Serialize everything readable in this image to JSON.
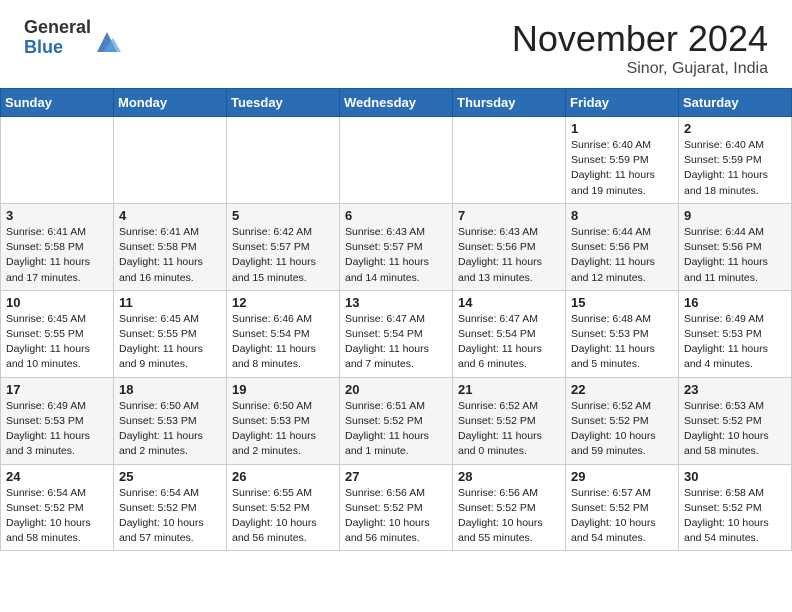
{
  "header": {
    "logo_general": "General",
    "logo_blue": "Blue",
    "month_title": "November 2024",
    "location": "Sinor, Gujarat, India"
  },
  "calendar": {
    "days_of_week": [
      "Sunday",
      "Monday",
      "Tuesday",
      "Wednesday",
      "Thursday",
      "Friday",
      "Saturday"
    ],
    "weeks": [
      [
        {
          "day": "",
          "info": ""
        },
        {
          "day": "",
          "info": ""
        },
        {
          "day": "",
          "info": ""
        },
        {
          "day": "",
          "info": ""
        },
        {
          "day": "",
          "info": ""
        },
        {
          "day": "1",
          "info": "Sunrise: 6:40 AM\nSunset: 5:59 PM\nDaylight: 11 hours and 19 minutes."
        },
        {
          "day": "2",
          "info": "Sunrise: 6:40 AM\nSunset: 5:59 PM\nDaylight: 11 hours and 18 minutes."
        }
      ],
      [
        {
          "day": "3",
          "info": "Sunrise: 6:41 AM\nSunset: 5:58 PM\nDaylight: 11 hours and 17 minutes."
        },
        {
          "day": "4",
          "info": "Sunrise: 6:41 AM\nSunset: 5:58 PM\nDaylight: 11 hours and 16 minutes."
        },
        {
          "day": "5",
          "info": "Sunrise: 6:42 AM\nSunset: 5:57 PM\nDaylight: 11 hours and 15 minutes."
        },
        {
          "day": "6",
          "info": "Sunrise: 6:43 AM\nSunset: 5:57 PM\nDaylight: 11 hours and 14 minutes."
        },
        {
          "day": "7",
          "info": "Sunrise: 6:43 AM\nSunset: 5:56 PM\nDaylight: 11 hours and 13 minutes."
        },
        {
          "day": "8",
          "info": "Sunrise: 6:44 AM\nSunset: 5:56 PM\nDaylight: 11 hours and 12 minutes."
        },
        {
          "day": "9",
          "info": "Sunrise: 6:44 AM\nSunset: 5:56 PM\nDaylight: 11 hours and 11 minutes."
        }
      ],
      [
        {
          "day": "10",
          "info": "Sunrise: 6:45 AM\nSunset: 5:55 PM\nDaylight: 11 hours and 10 minutes."
        },
        {
          "day": "11",
          "info": "Sunrise: 6:45 AM\nSunset: 5:55 PM\nDaylight: 11 hours and 9 minutes."
        },
        {
          "day": "12",
          "info": "Sunrise: 6:46 AM\nSunset: 5:54 PM\nDaylight: 11 hours and 8 minutes."
        },
        {
          "day": "13",
          "info": "Sunrise: 6:47 AM\nSunset: 5:54 PM\nDaylight: 11 hours and 7 minutes."
        },
        {
          "day": "14",
          "info": "Sunrise: 6:47 AM\nSunset: 5:54 PM\nDaylight: 11 hours and 6 minutes."
        },
        {
          "day": "15",
          "info": "Sunrise: 6:48 AM\nSunset: 5:53 PM\nDaylight: 11 hours and 5 minutes."
        },
        {
          "day": "16",
          "info": "Sunrise: 6:49 AM\nSunset: 5:53 PM\nDaylight: 11 hours and 4 minutes."
        }
      ],
      [
        {
          "day": "17",
          "info": "Sunrise: 6:49 AM\nSunset: 5:53 PM\nDaylight: 11 hours and 3 minutes."
        },
        {
          "day": "18",
          "info": "Sunrise: 6:50 AM\nSunset: 5:53 PM\nDaylight: 11 hours and 2 minutes."
        },
        {
          "day": "19",
          "info": "Sunrise: 6:50 AM\nSunset: 5:53 PM\nDaylight: 11 hours and 2 minutes."
        },
        {
          "day": "20",
          "info": "Sunrise: 6:51 AM\nSunset: 5:52 PM\nDaylight: 11 hours and 1 minute."
        },
        {
          "day": "21",
          "info": "Sunrise: 6:52 AM\nSunset: 5:52 PM\nDaylight: 11 hours and 0 minutes."
        },
        {
          "day": "22",
          "info": "Sunrise: 6:52 AM\nSunset: 5:52 PM\nDaylight: 10 hours and 59 minutes."
        },
        {
          "day": "23",
          "info": "Sunrise: 6:53 AM\nSunset: 5:52 PM\nDaylight: 10 hours and 58 minutes."
        }
      ],
      [
        {
          "day": "24",
          "info": "Sunrise: 6:54 AM\nSunset: 5:52 PM\nDaylight: 10 hours and 58 minutes."
        },
        {
          "day": "25",
          "info": "Sunrise: 6:54 AM\nSunset: 5:52 PM\nDaylight: 10 hours and 57 minutes."
        },
        {
          "day": "26",
          "info": "Sunrise: 6:55 AM\nSunset: 5:52 PM\nDaylight: 10 hours and 56 minutes."
        },
        {
          "day": "27",
          "info": "Sunrise: 6:56 AM\nSunset: 5:52 PM\nDaylight: 10 hours and 56 minutes."
        },
        {
          "day": "28",
          "info": "Sunrise: 6:56 AM\nSunset: 5:52 PM\nDaylight: 10 hours and 55 minutes."
        },
        {
          "day": "29",
          "info": "Sunrise: 6:57 AM\nSunset: 5:52 PM\nDaylight: 10 hours and 54 minutes."
        },
        {
          "day": "30",
          "info": "Sunrise: 6:58 AM\nSunset: 5:52 PM\nDaylight: 10 hours and 54 minutes."
        }
      ]
    ]
  }
}
